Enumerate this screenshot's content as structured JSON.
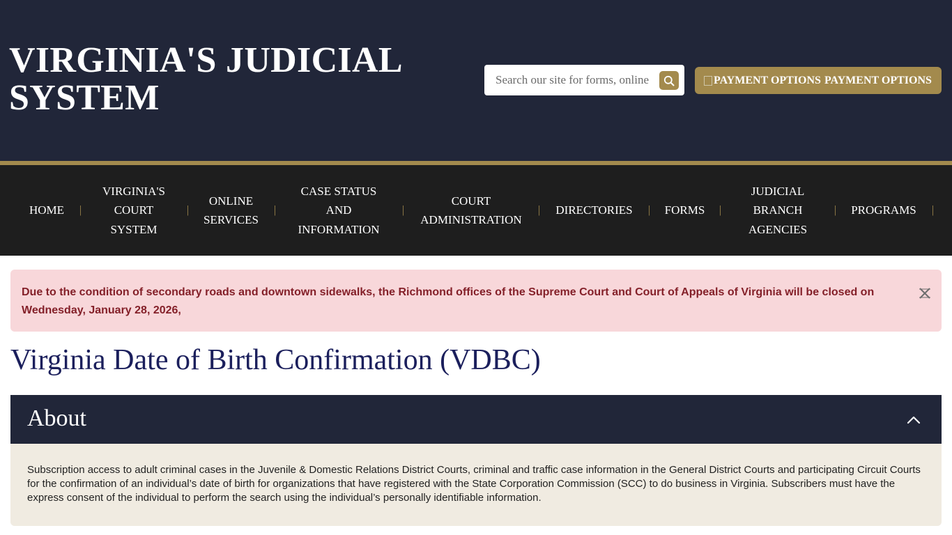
{
  "header": {
    "site_title": "VIRGINIA'S JUDICIAL SYSTEM",
    "search_placeholder": "Search our site for forms, online services, and more",
    "search_icon": "search-icon",
    "payment_button_label": "PAYMENT OPTIONS",
    "payment_image_alt": "PAYMENT OPTIONS",
    "colors": {
      "navy": "#212639",
      "gold": "#a38a4d"
    }
  },
  "nav": {
    "separator": "|",
    "items": [
      {
        "label": "HOME"
      },
      {
        "label": "VIRGINIA'S COURT SYSTEM"
      },
      {
        "label": "ONLINE SERVICES"
      },
      {
        "label": "CASE STATUS AND INFORMATION"
      },
      {
        "label": "COURT ADMINISTRATION"
      },
      {
        "label": "DIRECTORIES"
      },
      {
        "label": "FORMS"
      },
      {
        "label": "JUDICIAL BRANCH AGENCIES"
      },
      {
        "label": "PROGRAMS"
      }
    ]
  },
  "alert": {
    "text": "Due to the condition of secondary roads and downtown sidewalks, the Richmond offices of the Supreme Court and Court of Appeals of Virginia will be closed on Wednesday, January 28, 2026,",
    "close_icon": "close-icon",
    "colors": {
      "background": "#f8d7da",
      "text": "#842029"
    }
  },
  "main": {
    "page_title": "Virginia Date of Birth Confirmation (VDBC)",
    "section": {
      "title": "About",
      "expanded": true,
      "toggle_icon": "chevron-up-icon",
      "body": "Subscription access to adult criminal cases in the Juvenile & Domestic Relations District Courts, criminal and traffic case information in the General District Courts and participating Circuit Courts for the confirmation of an individual’s date of birth for organizations that have registered with the State Corporation Commission (SCC) to do business in Virginia. Subscribers must have the express consent of the individual to perform the search using the individual’s personally identifiable information."
    }
  }
}
